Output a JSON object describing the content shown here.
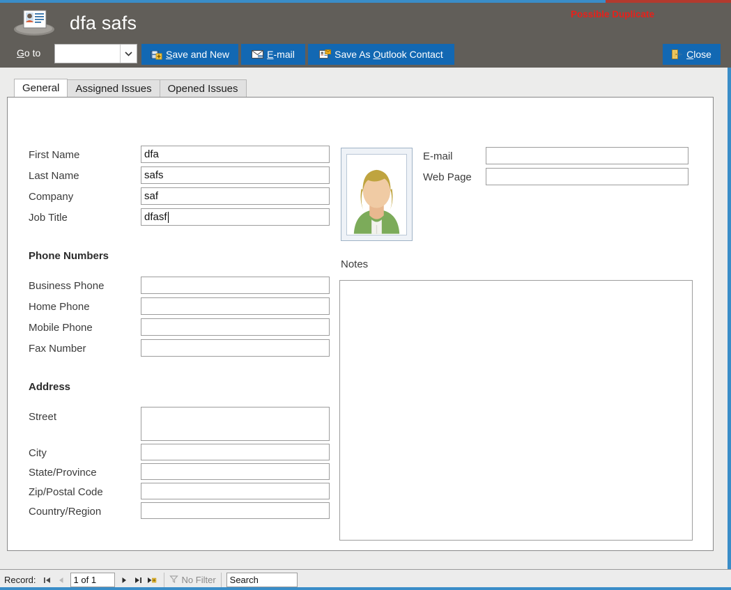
{
  "window": {
    "title": "dfa safs",
    "app_icon": "contact-card-icon",
    "accent_blue": "#3a8dc8",
    "accent_red": "#b33a2e",
    "header_bg": "#615e59",
    "button_blue": "#1268b3"
  },
  "header": {
    "duplicate_warning": "Possible Duplicate",
    "duplicate_warning_color": "#e8201a"
  },
  "toolbar": {
    "goto_label_pre": "G",
    "goto_label_post": "o to",
    "goto_value": "",
    "goto_icon": "chevron-down-icon",
    "buttons": [
      {
        "id": "save-and-new",
        "pre": "",
        "accel": "S",
        "post": "ave and New",
        "icon": "save-new-icon"
      },
      {
        "id": "email",
        "pre": "",
        "accel": "E",
        "post": "-mail",
        "icon": "email-icon"
      },
      {
        "id": "save-as-outlook-contact",
        "pre": "Save As ",
        "accel": "O",
        "post": "utlook Contact",
        "icon": "outlook-contact-icon"
      },
      {
        "id": "close",
        "pre": "",
        "accel": "C",
        "post": "lose",
        "icon": "close-door-icon"
      }
    ]
  },
  "tabs": [
    {
      "label": "General",
      "active": true
    },
    {
      "label": "Assigned Issues",
      "active": false
    },
    {
      "label": "Opened Issues",
      "active": false
    }
  ],
  "form": {
    "left_fields": [
      {
        "label": "First Name",
        "value": "dfa",
        "caret": false
      },
      {
        "label": "Last Name",
        "value": "safs",
        "caret": false
      },
      {
        "label": "Company",
        "value": "saf",
        "caret": false
      },
      {
        "label": "Job Title",
        "value": "dfasf",
        "caret": true
      }
    ],
    "phone_section": "Phone Numbers",
    "phone_fields": [
      {
        "label": "Business Phone",
        "value": ""
      },
      {
        "label": "Home Phone",
        "value": ""
      },
      {
        "label": "Mobile Phone",
        "value": ""
      },
      {
        "label": "Fax Number",
        "value": ""
      }
    ],
    "address_section": "Address",
    "address_fields": [
      {
        "label": "Street",
        "value": ""
      },
      {
        "label": "City",
        "value": ""
      },
      {
        "label": "State/Province",
        "value": ""
      },
      {
        "label": "Zip/Postal Code",
        "value": ""
      },
      {
        "label": "Country/Region",
        "value": ""
      }
    ],
    "photo_alt": "contact-photo-placeholder",
    "right_fields": [
      {
        "label": "E-mail",
        "value": ""
      },
      {
        "label": "Web Page",
        "value": ""
      }
    ],
    "notes_label": "Notes",
    "notes_value": ""
  },
  "statusbar": {
    "record_label": "Record:",
    "record_position": "1 of 1",
    "first_icon": "first-record-icon",
    "prev_icon": "previous-record-icon",
    "next_icon": "next-record-icon",
    "last_icon": "last-record-icon",
    "new_icon": "new-record-icon",
    "filter_icon": "filter-icon",
    "filter_label": "No Filter",
    "search_value": "Search"
  }
}
